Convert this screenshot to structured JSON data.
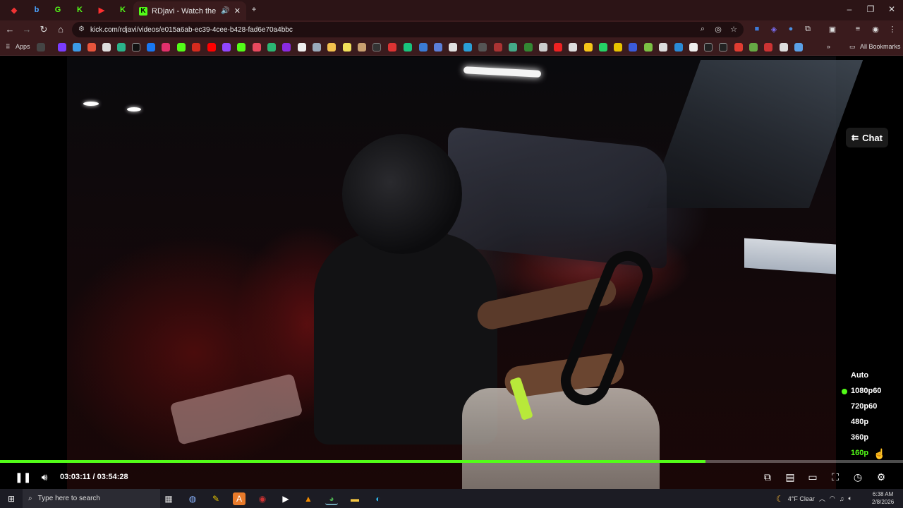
{
  "browser": {
    "active_tab_title": "RDjavi - Watch the VOD on",
    "active_tab_favicon": "K",
    "url": "kick.com/rdjavi/videos/e015a6ab-ec39-4cee-b428-fad6e70a4bbc",
    "bookmarks_apps_label": "Apps",
    "all_bookmarks_label": "All Bookmarks",
    "accent_color": "#53fc18"
  },
  "player": {
    "chat_label": "Chat",
    "current_time": "03:03:11",
    "duration": "03:54:28",
    "time_separator": "/",
    "progress_fraction": 0.781,
    "quality_options": [
      {
        "label": "Auto",
        "active_dot": false,
        "highlighted": false
      },
      {
        "label": "1080p60",
        "active_dot": true,
        "highlighted": false
      },
      {
        "label": "720p60",
        "active_dot": false,
        "highlighted": false
      },
      {
        "label": "480p",
        "active_dot": false,
        "highlighted": false
      },
      {
        "label": "360p",
        "active_dot": false,
        "highlighted": false
      },
      {
        "label": "160p",
        "active_dot": false,
        "highlighted": true
      }
    ]
  },
  "taskbar": {
    "search_placeholder": "Type here to search",
    "weather": "4°F  Clear",
    "time": "6:38 AM",
    "date": "2/8/2026"
  }
}
